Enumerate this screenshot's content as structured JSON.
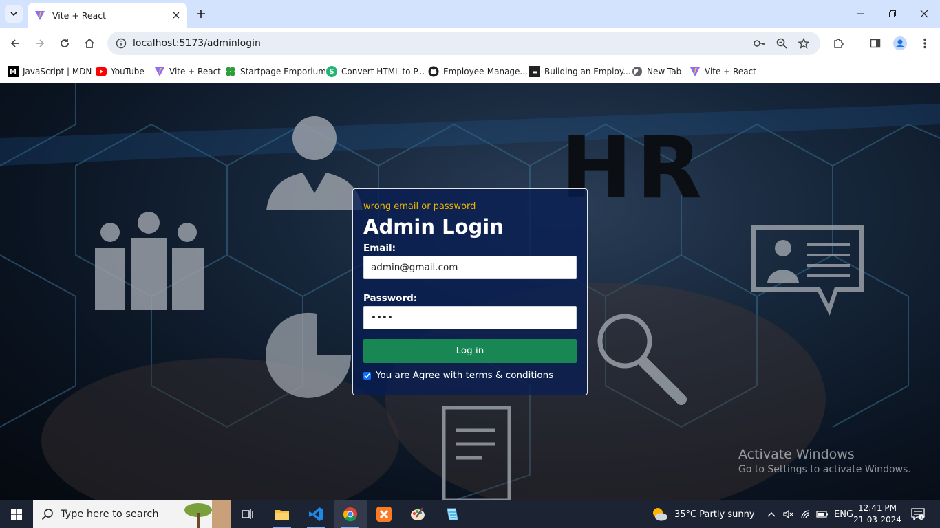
{
  "browser": {
    "tab_title": "Vite + React",
    "url": "localhost:5173/adminlogin",
    "bookmarks": [
      {
        "label": "JavaScript | MDN",
        "icon": "mdn-icon"
      },
      {
        "label": "YouTube",
        "icon": "youtube-icon"
      },
      {
        "label": "Vite + React",
        "icon": "vite-icon"
      },
      {
        "label": "Startpage Emporium",
        "icon": "clover-icon"
      },
      {
        "label": "Convert HTML to P...",
        "icon": "convert-icon"
      },
      {
        "label": "Employee-Manage...",
        "icon": "github-icon"
      },
      {
        "label": "Building an Employ...",
        "icon": "article-icon"
      },
      {
        "label": "New Tab",
        "icon": "globe-icon"
      },
      {
        "label": "Vite + React",
        "icon": "vite-icon"
      }
    ]
  },
  "page": {
    "background_text": "HR",
    "login": {
      "error": "wrong email or password",
      "title": "Admin Login",
      "email_label": "Email:",
      "email_value": "admin@gmail.com",
      "password_label": "Password:",
      "password_value": "••••",
      "submit_label": "Log in",
      "agree_label": "You are Agree with terms & conditions",
      "agree_checked": true
    },
    "watermark": {
      "line1": "Activate Windows",
      "line2": "Go to Settings to activate Windows."
    }
  },
  "taskbar": {
    "search_placeholder": "Type here to search",
    "weather": "35°C  Partly sunny",
    "language": "ENG",
    "time": "12:41 PM",
    "date": "21-03-2024"
  },
  "colors": {
    "tab_strip": "#d3e3fd",
    "login_button": "#198754",
    "error_text": "#f0b400",
    "taskbar": "#1c2333"
  }
}
